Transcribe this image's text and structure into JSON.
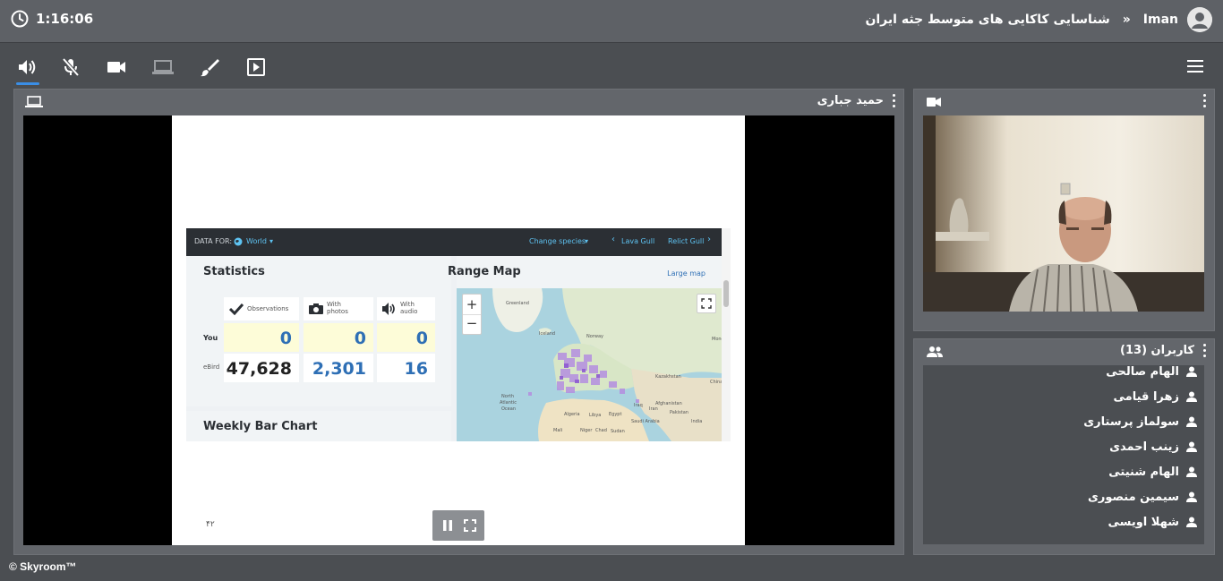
{
  "header": {
    "clock": "1:16:06",
    "room_title": "شناسایی کاکایی های متوسط جثه ایران",
    "separator": "»",
    "user_name": "Iman"
  },
  "toolbar": {
    "icons": [
      "speaker-icon",
      "mic-muted-icon",
      "camera-icon",
      "screen-share-icon",
      "brush-icon",
      "play-box-icon"
    ],
    "menu_icon": "hamburger-menu-icon"
  },
  "main_panel": {
    "presenter": "حمید جباری",
    "slide": {
      "page_number": "۴۲",
      "ebird": {
        "data_for_label": "DATA FOR:",
        "region": "World",
        "change_species": "Change species",
        "prev_species": "Lava Gull",
        "next_species": "Relict Gull",
        "statistics_title": "Statistics",
        "range_map_title": "Range Map",
        "large_map": "Large map",
        "weekly_title": "Weekly Bar Chart",
        "columns": [
          "Observations",
          "With photos",
          "With audio"
        ],
        "rows": [
          {
            "label": "You",
            "values": [
              "0",
              "0",
              "0"
            ]
          },
          {
            "label": "eBird",
            "values": [
              "47,628",
              "2,301",
              "16"
            ]
          }
        ],
        "map_labels": [
          "Greenland",
          "Iceland",
          "Norway",
          "Kazakhstan",
          "North Atlantic Ocean",
          "Algeria",
          "Libya",
          "Egypt",
          "Mali",
          "Niger",
          "Chad",
          "Sudan",
          "Afghanistan",
          "Iran",
          "Iraq",
          "Pakistan",
          "India",
          "Mongolia",
          "China",
          "Saudi Arabia"
        ]
      }
    }
  },
  "camera_panel": {
    "icon": "video-camera-icon"
  },
  "users_panel": {
    "title": "کاربران (13)",
    "users": [
      "الهام صالحی",
      "زهرا قیامی",
      "سولماز پرستاری",
      "زینب احمدی",
      "الهام شنیتی",
      "سیمین منصوری",
      "شهلا اویسی"
    ]
  },
  "footer": {
    "brand": "© Skyroom™"
  },
  "colors": {
    "accent": "#3a8ee6",
    "ebird_blue": "#2e6fb5",
    "ebird_dark": "#2b2f34"
  }
}
